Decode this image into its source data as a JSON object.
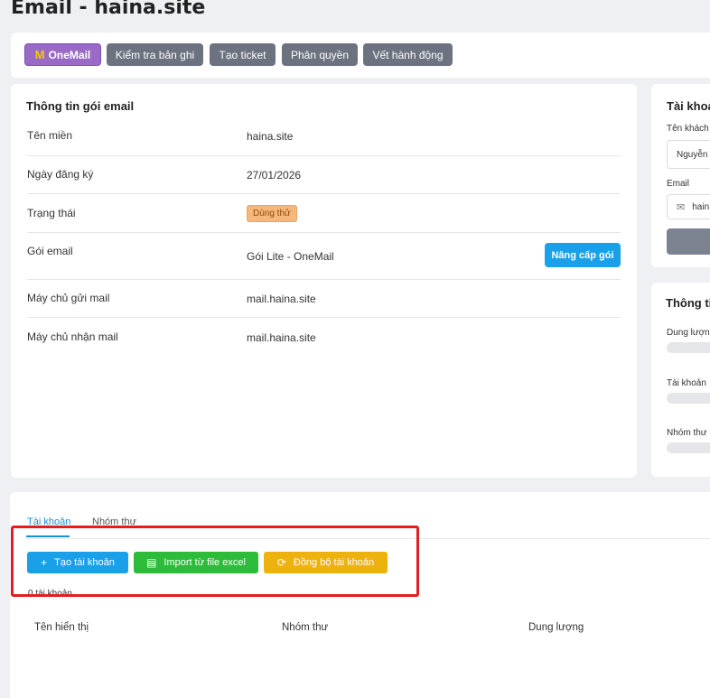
{
  "page": {
    "title": "Email - haina.site"
  },
  "toolbar": {
    "onemail_label": "OneMail",
    "logs_label": "Kiểm tra bản ghi",
    "ticket_label": "Tạo ticket",
    "permission_label": "Phân quyền",
    "actions_label": "Vết hành động"
  },
  "info": {
    "title": "Thông tin gói email",
    "rows": [
      {
        "label": "Tên miền",
        "value": "haina.site"
      },
      {
        "label": "Ngày đăng ký",
        "value": "27/01/2026"
      },
      {
        "label": "Trạng thái",
        "value": "Dùng thử"
      },
      {
        "label": "Gói email",
        "value": "Gói Lite - OneMail"
      },
      {
        "label": "Máy chủ gửi mail",
        "value": "mail.haina.site"
      },
      {
        "label": "Máy chủ nhận mail",
        "value": "mail.haina.site"
      }
    ],
    "upgrade_label": "Nâng cấp gói"
  },
  "account": {
    "title": "Tài khoả",
    "customer_label": "Tên khách h",
    "customer_value": "Nguyễn .",
    "email_label": "Email",
    "email_value": "hain"
  },
  "stats": {
    "title": "Thông ti",
    "capacity_label": "Dung lượng",
    "accounts_label": "Tài khoản",
    "groups_label": "Nhóm thư"
  },
  "tabs": [
    {
      "label": "Tài khoản",
      "active": true
    },
    {
      "label": "Nhóm thư",
      "active": false
    }
  ],
  "actions": {
    "create_label": "Tạo tài khoản",
    "import_label": "Import từ file excel",
    "sync_label": "Đồng bộ tài khoản"
  },
  "accounts": {
    "count_text": "0 tài khoản",
    "columns": [
      "Tên hiển thị",
      "Nhóm thư",
      "Dung lượng"
    ]
  },
  "colors": {
    "primary": "#1aa0e8",
    "success": "#2dbb3a",
    "warning": "#eeb20f",
    "highlight": "#e41e1e"
  }
}
